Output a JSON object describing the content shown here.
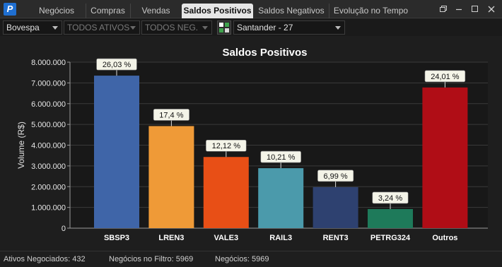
{
  "app": {
    "logo_text": "P"
  },
  "tabs": [
    {
      "label": "Negócios",
      "active": false
    },
    {
      "label": "Compras",
      "active": false
    },
    {
      "label": "Vendas",
      "active": false
    },
    {
      "label": "Saldos Positivos",
      "active": true
    },
    {
      "label": "Saldos Negativos",
      "active": false
    },
    {
      "label": "Evolução no Tempo",
      "active": false
    }
  ],
  "toolbar": {
    "exchange": "Bovespa",
    "assets": "TODOS ATIVOS",
    "trades": "TODOS NEG.",
    "broker": "Santander - 27"
  },
  "icons": {
    "restore": "restore-window-icon",
    "minimize": "minimize-icon",
    "maximize": "maximize-icon",
    "close": "close-icon",
    "grid": "grid-layout-icon"
  },
  "colors": {
    "accent": "#1f6fd1",
    "plot_bg": "#181818",
    "grid": "#3a3a3a"
  },
  "chart_data": {
    "type": "bar",
    "title": "Saldos Positivos",
    "ylabel": "Volume (R$)",
    "xlabel": "",
    "ylim": [
      0,
      8000000
    ],
    "yticks": [
      0,
      1000000,
      2000000,
      3000000,
      4000000,
      5000000,
      6000000,
      7000000,
      8000000
    ],
    "ytick_labels": [
      "0",
      "1.000.000",
      "2.000.000",
      "3.000.000",
      "4.000.000",
      "5.000.000",
      "6.000.000",
      "7.000.000",
      "8.000.000"
    ],
    "categories": [
      "SBSP3",
      "LREN3",
      "VALE3",
      "RAIL3",
      "RENT3",
      "PETRG324",
      "Outros"
    ],
    "values": [
      7350000,
      4920000,
      3430000,
      2890000,
      1980000,
      920000,
      6780000
    ],
    "data_labels": [
      "26,03 %",
      "17,4 %",
      "12,12 %",
      "10,21 %",
      "6,99 %",
      "3,24 %",
      "24,01 %"
    ],
    "colors": [
      "#3f65a8",
      "#ef9a37",
      "#e84f16",
      "#4b9aab",
      "#2e4170",
      "#1e7a5a",
      "#b00d16"
    ],
    "grid": true,
    "legend": "none"
  },
  "status": {
    "assets_traded": "Ativos Negociados: 432",
    "filtered_trades": "Negócios no Filtro: 5969",
    "trades": "Negócios: 5969"
  }
}
